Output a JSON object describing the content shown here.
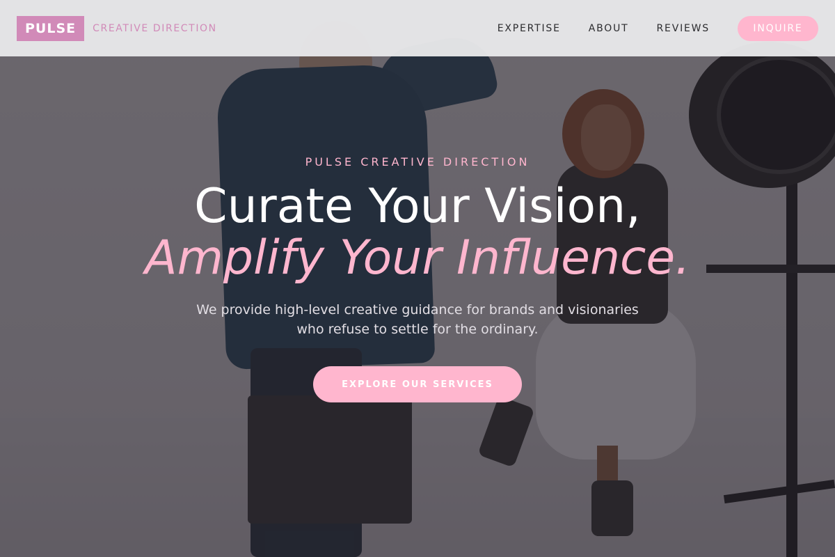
{
  "colors": {
    "brand_pink": "#d18ab8",
    "accent_pink": "#ffb6ce",
    "header_bg": "#e8e8ea",
    "nav_text": "#2b2b2e",
    "overlay": "#28242c"
  },
  "header": {
    "logo": "PULSE",
    "tagline": "CREATIVE DIRECTION",
    "nav": [
      {
        "label": "EXPERTISE"
      },
      {
        "label": "ABOUT"
      },
      {
        "label": "REVIEWS"
      }
    ],
    "cta_label": "INQUIRE"
  },
  "hero": {
    "eyebrow": "PULSE CREATIVE DIRECTION",
    "headline_line1": "Curate Your Vision,",
    "headline_line2": "Amplify Your Influence.",
    "subcopy_line1": "We provide high-level creative guidance for brands and visionaries",
    "subcopy_line2": "who refuse to settle for the ordinary.",
    "cta_label": "EXPLORE OUR SERVICES",
    "background_image": "photographer shooting a smiling model in a studio with a studio light"
  }
}
